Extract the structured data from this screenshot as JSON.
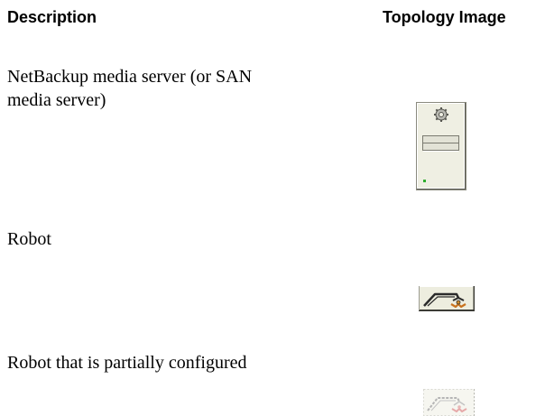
{
  "table": {
    "headers": {
      "description": "Description",
      "topology_image": "Topology Image"
    },
    "rows": [
      {
        "description": "NetBackup media server (or SAN",
        "description_line2": "media server)",
        "icon": "media-server-icon"
      },
      {
        "description": "Robot",
        "icon": "robot-icon"
      },
      {
        "description": "Robot that is partially configured",
        "icon": "robot-partially-configured-icon"
      }
    ]
  }
}
